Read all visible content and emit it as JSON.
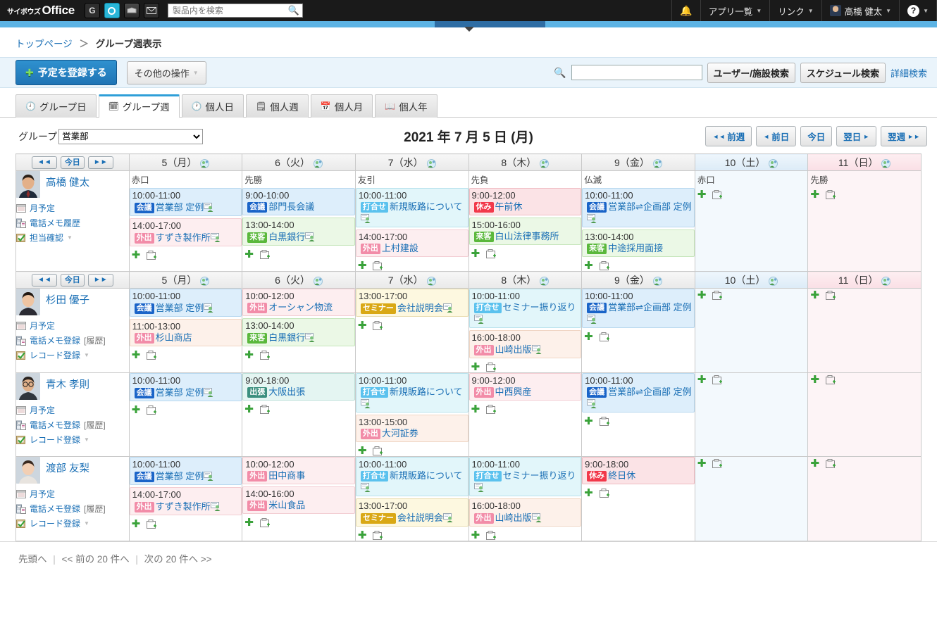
{
  "header": {
    "logo_cy": "サイボウズ",
    "logo_office": "Office",
    "app_icons": [
      {
        "name": "garoon-icon",
        "label": "G"
      },
      {
        "name": "office-icon",
        "label": "O"
      },
      {
        "name": "mailwise-icon",
        "label": ""
      },
      {
        "name": "mail-icon",
        "label": "✉"
      }
    ],
    "search_placeholder": "製品内を検索",
    "search_value": "",
    "notification_label": "",
    "app_list_label": "アプリ一覧",
    "link_label": "リンク",
    "user_label": "高橋 健太",
    "help_label": "?"
  },
  "breadcrumb": {
    "home": "トップページ",
    "separator": "＞",
    "current": "グループ週表示"
  },
  "toolbar": {
    "register_label": "予定を登録する",
    "other_ops_label": "その他の操作",
    "search_value": "",
    "user_facility_search": "ユーザー/施設検索",
    "schedule_search": "スケジュール検索",
    "detail_search": "詳細検索"
  },
  "tabs": [
    {
      "label": "グループ日",
      "icon": "clock-people-icon",
      "active": false
    },
    {
      "label": "グループ週",
      "icon": "week-people-icon",
      "active": true
    },
    {
      "label": "個人日",
      "icon": "clock-icon",
      "active": false
    },
    {
      "label": "個人週",
      "icon": "week-icon",
      "active": false
    },
    {
      "label": "個人月",
      "icon": "month-icon",
      "active": false
    },
    {
      "label": "個人年",
      "icon": "year-icon",
      "active": false
    }
  ],
  "controls": {
    "group_label": "グループ",
    "group_selected": "営業部",
    "group_options": [
      "営業部"
    ],
    "date_title": "2021 年 7 月 5 日 (月)",
    "nav_buttons": [
      {
        "label": "前週",
        "arrow": "◄◄",
        "arrow_side": "left"
      },
      {
        "label": "前日",
        "arrow": "◄",
        "arrow_side": "left"
      },
      {
        "label": "今日",
        "arrow": "",
        "arrow_side": "none"
      },
      {
        "label": "翌日",
        "arrow": "►",
        "arrow_side": "right"
      },
      {
        "label": "翌週",
        "arrow": "►►",
        "arrow_side": "right"
      }
    ]
  },
  "row_nav": {
    "prev": "◄◄",
    "today": "今日",
    "next": "►►"
  },
  "days": [
    {
      "label": "5（月）",
      "type": "weekday"
    },
    {
      "label": "6（火）",
      "type": "weekday"
    },
    {
      "label": "7（水）",
      "type": "weekday"
    },
    {
      "label": "8（木）",
      "type": "weekday"
    },
    {
      "label": "9（金）",
      "type": "weekday"
    },
    {
      "label": "10（土）",
      "type": "sat"
    },
    {
      "label": "11（日）",
      "type": "sun"
    }
  ],
  "rokuyo_row1": [
    "赤口",
    "先勝",
    "友引",
    "先負",
    "仏滅",
    "赤口",
    "先勝"
  ],
  "users": [
    {
      "name": "高橋 健太",
      "avatar": "male-suit",
      "links": [
        {
          "label": "月予定",
          "icon": "calendar-icon",
          "sub": ""
        },
        {
          "label": "電話メモ履歴",
          "icon": "phone-memo-icon",
          "sub": ""
        },
        {
          "label": "担当確認",
          "icon": "check-icon",
          "sub": "",
          "caret": true
        }
      ],
      "cells": [
        {
          "day": 0,
          "events": [
            {
              "time": "10:00-11:00",
              "badge": "会議",
              "badge_class": "b-kaigi",
              "title": "営業部 定例",
              "color": "blue",
              "person": true
            },
            {
              "time": "14:00-17:00",
              "badge": "外出",
              "badge_class": "b-gaishutsu",
              "title": "すずき製作所",
              "color": "pink",
              "person": true
            }
          ]
        },
        {
          "day": 1,
          "events": [
            {
              "time": "9:00-10:00",
              "badge": "会議",
              "badge_class": "b-kaigi",
              "title": "部門長会議",
              "color": "blue",
              "person": false
            },
            {
              "time": "13:00-14:00",
              "badge": "来客",
              "badge_class": "b-raikyaku",
              "title": "白黒銀行",
              "color": "green",
              "person": true
            }
          ]
        },
        {
          "day": 2,
          "events": [
            {
              "time": "10:00-11:00",
              "badge": "打合せ",
              "badge_class": "b-uchiawase",
              "title": "新規販路について",
              "color": "cyan",
              "person": true
            },
            {
              "time": "14:00-17:00",
              "badge": "外出",
              "badge_class": "b-gaishutsu",
              "title": "上村建設",
              "color": "pink",
              "person": false
            }
          ]
        },
        {
          "day": 3,
          "events": [
            {
              "time": "9:00-12:00",
              "badge": "休み",
              "badge_class": "b-yasumi",
              "title": "午前休",
              "color": "rose",
              "person": false
            },
            {
              "time": "15:00-16:00",
              "badge": "来客",
              "badge_class": "b-raikyaku",
              "title": "白山法律事務所",
              "color": "green",
              "person": false
            }
          ]
        },
        {
          "day": 4,
          "events": [
            {
              "time": "10:00-11:00",
              "badge": "会議",
              "badge_class": "b-kaigi",
              "title": "営業部⇌企画部 定例",
              "color": "blue",
              "person": true
            },
            {
              "time": "13:00-14:00",
              "badge": "来客",
              "badge_class": "b-raikyaku",
              "title": "中途採用面接",
              "color": "green",
              "person": false
            }
          ]
        },
        {
          "day": 5,
          "events": []
        },
        {
          "day": 6,
          "events": []
        }
      ]
    },
    {
      "name": "杉田 優子",
      "avatar": "female-dark",
      "links": [
        {
          "label": "月予定",
          "icon": "calendar-icon",
          "sub": ""
        },
        {
          "label": "電話メモ登録",
          "icon": "phone-memo-icon",
          "sub": "[履歴]"
        },
        {
          "label": "レコード登録",
          "icon": "check-icon",
          "sub": "",
          "caret": true
        }
      ],
      "cells": [
        {
          "day": 0,
          "events": [
            {
              "time": "10:00-11:00",
              "badge": "会議",
              "badge_class": "b-kaigi",
              "title": "営業部 定例",
              "color": "blue",
              "person": true
            },
            {
              "time": "11:00-13:00",
              "badge": "外出",
              "badge_class": "b-gaishutsu",
              "title": "杉山商店",
              "color": "peach",
              "person": false
            }
          ]
        },
        {
          "day": 1,
          "events": [
            {
              "time": "10:00-12:00",
              "badge": "外出",
              "badge_class": "b-gaishutsu",
              "title": "オーシャン物流",
              "color": "pink",
              "person": false
            },
            {
              "time": "13:00-14:00",
              "badge": "来客",
              "badge_class": "b-raikyaku",
              "title": "白黒銀行",
              "color": "green",
              "person": true
            }
          ]
        },
        {
          "day": 2,
          "events": [
            {
              "time": "13:00-17:00",
              "badge": "セミナー",
              "badge_class": "b-seminar",
              "title": "会社説明会",
              "color": "yellow",
              "person": true
            }
          ]
        },
        {
          "day": 3,
          "events": [
            {
              "time": "10:00-11:00",
              "badge": "打合せ",
              "badge_class": "b-uchiawase",
              "title": "セミナー振り返り",
              "color": "cyan",
              "person": true
            },
            {
              "time": "16:00-18:00",
              "badge": "外出",
              "badge_class": "b-gaishutsu",
              "title": "山崎出版",
              "color": "peach",
              "person": true
            }
          ]
        },
        {
          "day": 4,
          "events": [
            {
              "time": "10:00-11:00",
              "badge": "会議",
              "badge_class": "b-kaigi",
              "title": "営業部⇌企画部 定例",
              "color": "blue",
              "person": true
            }
          ]
        },
        {
          "day": 5,
          "events": []
        },
        {
          "day": 6,
          "events": []
        }
      ]
    },
    {
      "name": "青木 孝則",
      "avatar": "male-glasses",
      "links": [
        {
          "label": "月予定",
          "icon": "calendar-icon",
          "sub": ""
        },
        {
          "label": "電話メモ登録",
          "icon": "phone-memo-icon",
          "sub": "[履歴]"
        },
        {
          "label": "レコード登録",
          "icon": "check-icon",
          "sub": "",
          "caret": true
        }
      ],
      "cells": [
        {
          "day": 0,
          "events": [
            {
              "time": "10:00-11:00",
              "badge": "会議",
              "badge_class": "b-kaigi",
              "title": "営業部 定例",
              "color": "blue",
              "person": true
            }
          ]
        },
        {
          "day": 1,
          "events": [
            {
              "time": "9:00-18:00",
              "badge": "出張",
              "badge_class": "b-shuccho",
              "title": "大阪出張",
              "color": "teal",
              "person": false
            }
          ]
        },
        {
          "day": 2,
          "events": [
            {
              "time": "10:00-11:00",
              "badge": "打合せ",
              "badge_class": "b-uchiawase",
              "title": "新規販路について",
              "color": "cyan",
              "person": true
            },
            {
              "time": "13:00-15:00",
              "badge": "外出",
              "badge_class": "b-gaishutsu",
              "title": "大河証券",
              "color": "peach",
              "person": false
            }
          ]
        },
        {
          "day": 3,
          "events": [
            {
              "time": "9:00-12:00",
              "badge": "外出",
              "badge_class": "b-gaishutsu",
              "title": "中西興産",
              "color": "pink",
              "person": false
            }
          ]
        },
        {
          "day": 4,
          "events": [
            {
              "time": "10:00-11:00",
              "badge": "会議",
              "badge_class": "b-kaigi",
              "title": "営業部⇌企画部 定例",
              "color": "blue",
              "person": true
            }
          ]
        },
        {
          "day": 5,
          "events": []
        },
        {
          "day": 6,
          "events": []
        }
      ]
    },
    {
      "name": "渡部 友梨",
      "avatar": "female-light",
      "links": [
        {
          "label": "月予定",
          "icon": "calendar-icon",
          "sub": ""
        },
        {
          "label": "電話メモ登録",
          "icon": "phone-memo-icon",
          "sub": "[履歴]"
        },
        {
          "label": "レコード登録",
          "icon": "check-icon",
          "sub": "",
          "caret": true
        }
      ],
      "cells": [
        {
          "day": 0,
          "events": [
            {
              "time": "10:00-11:00",
              "badge": "会議",
              "badge_class": "b-kaigi",
              "title": "営業部 定例",
              "color": "blue",
              "person": true
            },
            {
              "time": "14:00-17:00",
              "badge": "外出",
              "badge_class": "b-gaishutsu",
              "title": "すずき製作所",
              "color": "pink",
              "person": true
            }
          ]
        },
        {
          "day": 1,
          "events": [
            {
              "time": "10:00-12:00",
              "badge": "外出",
              "badge_class": "b-gaishutsu",
              "title": "田中商事",
              "color": "pink",
              "person": false
            },
            {
              "time": "14:00-16:00",
              "badge": "外出",
              "badge_class": "b-gaishutsu",
              "title": "米山食品",
              "color": "pink",
              "person": false
            }
          ]
        },
        {
          "day": 2,
          "events": [
            {
              "time": "10:00-11:00",
              "badge": "打合せ",
              "badge_class": "b-uchiawase",
              "title": "新規販路について",
              "color": "cyan",
              "person": true
            },
            {
              "time": "13:00-17:00",
              "badge": "セミナー",
              "badge_class": "b-seminar",
              "title": "会社説明会",
              "color": "yellow",
              "person": true
            }
          ]
        },
        {
          "day": 3,
          "events": [
            {
              "time": "10:00-11:00",
              "badge": "打合せ",
              "badge_class": "b-uchiawase",
              "title": "セミナー振り返り",
              "color": "cyan",
              "person": true
            },
            {
              "time": "16:00-18:00",
              "badge": "外出",
              "badge_class": "b-gaishutsu",
              "title": "山崎出版",
              "color": "peach",
              "person": true
            }
          ]
        },
        {
          "day": 4,
          "events": [
            {
              "time": "9:00-18:00",
              "badge": "休み",
              "badge_class": "b-yasumi",
              "title": "終日休",
              "color": "rose",
              "person": false
            }
          ]
        },
        {
          "day": 5,
          "events": []
        },
        {
          "day": 6,
          "events": []
        }
      ]
    }
  ],
  "footer": {
    "top": "先頭へ",
    "prev": "<< 前の 20 件へ",
    "next": "次の 20 件へ >>"
  }
}
